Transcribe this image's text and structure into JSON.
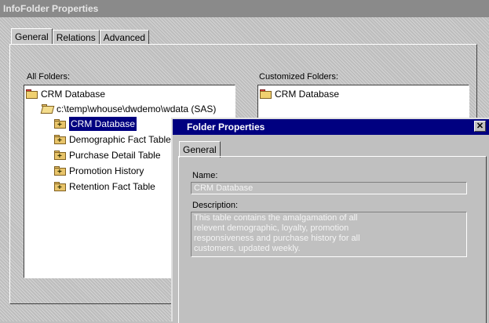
{
  "window": {
    "title": "InfoFolder Properties"
  },
  "tabs": [
    {
      "label": "General"
    },
    {
      "label": "Relations"
    },
    {
      "label": "Advanced"
    }
  ],
  "all_folders": {
    "label": "All Folders:",
    "root": "CRM Database",
    "path": "c:\\temp\\whouse\\dwdemo\\wdata (SAS)",
    "items": [
      {
        "label": "CRM Database"
      },
      {
        "label": "Demographic Fact Table"
      },
      {
        "label": "Purchase Detail Table"
      },
      {
        "label": "Promotion History"
      },
      {
        "label": "Retention Fact Table"
      }
    ]
  },
  "customized_folders": {
    "label": "Customized Folders:",
    "items": [
      {
        "label": "CRM Database"
      }
    ]
  },
  "dialog": {
    "title": "Folder Properties",
    "close_glyph": "✕",
    "tab": "General",
    "name_label": "Name:",
    "name_value": "CRM Database",
    "description_label": "Description:",
    "description_value": "This table contains the amalgamation of all relevent demographic, loyalty, promotion responsiveness and purchase history for all customers, updated weekly."
  }
}
